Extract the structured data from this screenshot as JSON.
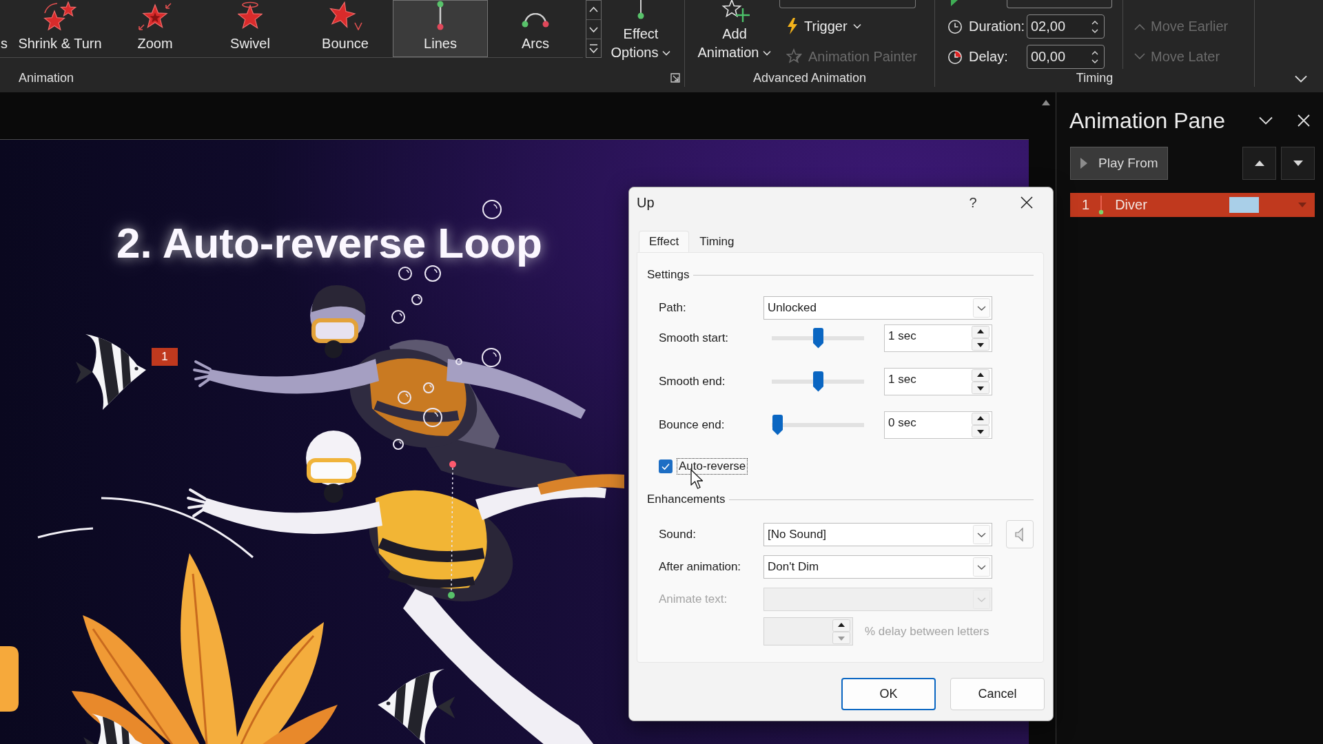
{
  "ribbon": {
    "animation_group": {
      "effects": [
        {
          "label": "s",
          "kind": "partial",
          "selected": false
        },
        {
          "label": "Shrink & Turn",
          "kind": "shrink",
          "selected": false
        },
        {
          "label": "Zoom",
          "kind": "zoom",
          "selected": false
        },
        {
          "label": "Swivel",
          "kind": "swivel",
          "selected": false
        },
        {
          "label": "Bounce",
          "kind": "bounce",
          "selected": false
        },
        {
          "label": "Lines",
          "kind": "lines",
          "selected": true
        },
        {
          "label": "Arcs",
          "kind": "arcs",
          "selected": false
        }
      ],
      "effect_options": [
        "Effect",
        "Options"
      ],
      "group_label": "Animation"
    },
    "advanced_animation_group": {
      "add_animation": [
        "Add",
        "Animation"
      ],
      "buttons": [
        {
          "label": "Trigger",
          "kind": "trigger",
          "disabled": false
        },
        {
          "label": "Animation Painter",
          "kind": "painter",
          "disabled": true
        }
      ],
      "group_label": "Advanced Animation"
    },
    "timing_group": {
      "fields": [
        {
          "label": "Duration:",
          "kind": "duration",
          "value": "02,00"
        },
        {
          "label": "Delay:",
          "kind": "delay",
          "value": "00,00"
        }
      ],
      "order_buttons": [
        {
          "label": "Move Earlier",
          "kind": "earlier",
          "disabled": true
        },
        {
          "label": "Move Later",
          "kind": "later",
          "disabled": true
        }
      ],
      "group_label": "Timing"
    }
  },
  "slide": {
    "title": "2. Auto-reverse Loop",
    "animation_tag": "1"
  },
  "animation_pane": {
    "title": "Animation Pane",
    "play_button": "Play From",
    "items": [
      {
        "number": "1",
        "name": "Diver",
        "selected": true
      }
    ]
  },
  "dialog": {
    "title": "Up",
    "help": "?",
    "tabs": [
      {
        "label": "Effect",
        "selected": true
      },
      {
        "label": "Timing",
        "selected": false
      }
    ],
    "settings": {
      "heading": "Settings",
      "path": {
        "label": "Path:",
        "value": "Unlocked"
      },
      "sliders": [
        {
          "label": "Smooth start:",
          "level": 0.5,
          "value": "1 sec"
        },
        {
          "label": "Smooth end:",
          "level": 0.5,
          "value": "1 sec"
        },
        {
          "label": "Bounce end:",
          "level": 0,
          "value": "0 sec"
        }
      ],
      "auto_reverse": {
        "label": "Auto-reverse",
        "checked": true,
        "focused": true
      }
    },
    "enhancements": {
      "heading": "Enhancements",
      "dropdowns": [
        {
          "label": "Sound:",
          "value": "[No Sound]",
          "kind": "sound",
          "disabled": false
        },
        {
          "label": "After animation:",
          "value": "Don't Dim",
          "kind": "plain",
          "disabled": false
        },
        {
          "label": "Animate text:",
          "kind": "plain",
          "disabled": true
        }
      ],
      "letter_delay": {
        "label": "% delay between letters",
        "disabled": true
      }
    },
    "buttons": [
      {
        "label": "OK",
        "default": true
      },
      {
        "label": "Cancel",
        "default": false
      }
    ]
  }
}
